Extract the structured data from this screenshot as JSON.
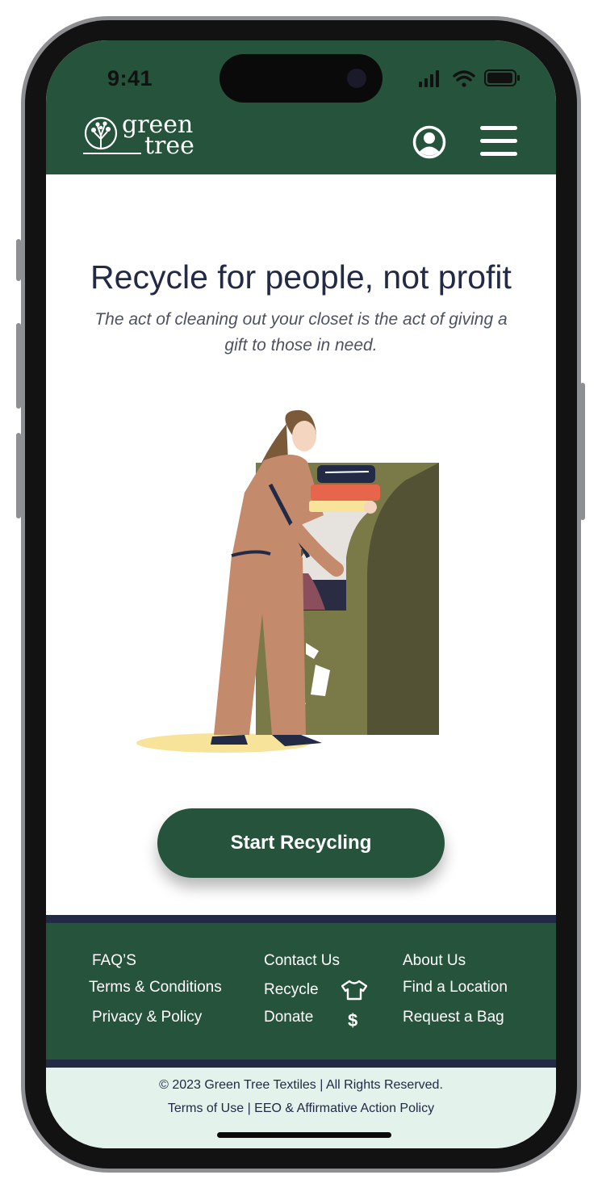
{
  "status_bar": {
    "time": "9:41"
  },
  "brand": {
    "name_line1": "green",
    "name_line2": "tree"
  },
  "header": {
    "user_icon": "user-circle-icon",
    "menu_icon": "hamburger-menu-icon"
  },
  "hero": {
    "title": "Recycle for people, not profit",
    "subtitle": "The act of cleaning out your closet is the act of giving a gift to those in need."
  },
  "cta": {
    "label": "Start Recycling"
  },
  "footer": {
    "col1": [
      "FAQ’S",
      "Terms & Conditions",
      "Privacy & Policy"
    ],
    "col2": [
      "Contact Us",
      "Recycle",
      "Donate"
    ],
    "col2_icons": [
      "tshirt-icon",
      "dollar-icon"
    ],
    "col3": [
      "About Us",
      "Find a Location",
      "Request a Bag"
    ],
    "dollar_glyph": "$"
  },
  "legal": {
    "copyright": "© 2023 Green Tree Textiles | All Rights Reserved.",
    "links": "Terms of Use | EEO & Affirmative Action Policy"
  },
  "colors": {
    "brand_green": "#26533b",
    "navy": "#232a45",
    "legal_bg": "#e3f2eb",
    "bin_olive": "#7a7948",
    "bin_shadow": "#545235"
  }
}
